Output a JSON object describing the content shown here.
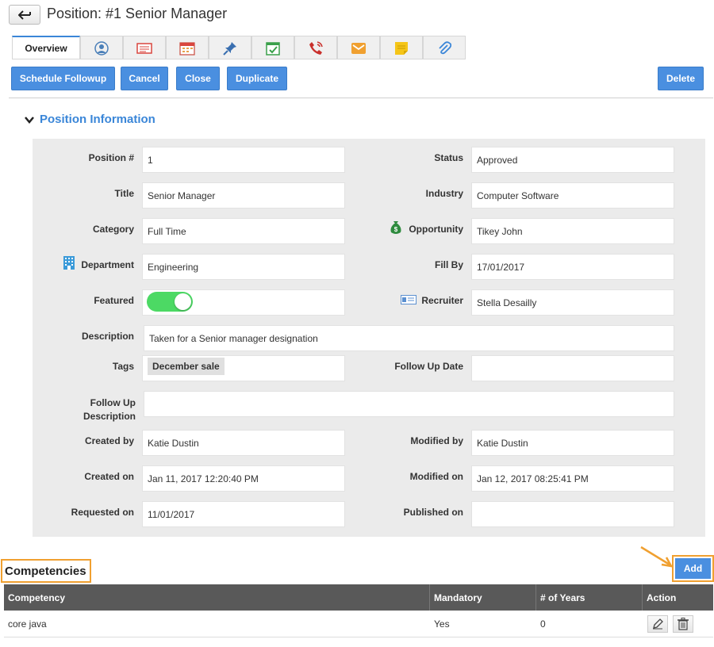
{
  "header": {
    "title": "Position: #1 Senior Manager",
    "back_icon": "back-arrow-icon"
  },
  "tabs": [
    {
      "label": "Overview",
      "icon": "",
      "active": true
    },
    {
      "label": "",
      "icon": "contacts-icon"
    },
    {
      "label": "",
      "icon": "notes-card-icon"
    },
    {
      "label": "",
      "icon": "calendar-icon"
    },
    {
      "label": "",
      "icon": "pin-icon"
    },
    {
      "label": "",
      "icon": "task-calendar-icon"
    },
    {
      "label": "",
      "icon": "phone-call-icon"
    },
    {
      "label": "",
      "icon": "email-icon"
    },
    {
      "label": "",
      "icon": "sticky-note-icon"
    },
    {
      "label": "",
      "icon": "attachment-icon"
    }
  ],
  "toolbar": {
    "schedule_followup": "Schedule Followup",
    "cancel": "Cancel",
    "close": "Close",
    "duplicate": "Duplicate",
    "delete": "Delete"
  },
  "section": {
    "title": "Position Information"
  },
  "fields": {
    "position_no": {
      "label": "Position #",
      "value": "1"
    },
    "status": {
      "label": "Status",
      "value": "Approved"
    },
    "title": {
      "label": "Title",
      "value": "Senior Manager"
    },
    "industry": {
      "label": "Industry",
      "value": "Computer Software"
    },
    "category": {
      "label": "Category",
      "value": "Full Time"
    },
    "opportunity": {
      "label": "Opportunity",
      "value": "Tikey John"
    },
    "department": {
      "label": "Department",
      "value": "Engineering"
    },
    "fill_by": {
      "label": "Fill By",
      "value": "17/01/2017"
    },
    "featured": {
      "label": "Featured",
      "value": true
    },
    "recruiter": {
      "label": "Recruiter",
      "value": "Stella Desailly"
    },
    "description": {
      "label": "Description",
      "value": "Taken for a Senior manager designation"
    },
    "tags": {
      "label": "Tags",
      "value": "December sale"
    },
    "follow_up_date": {
      "label": "Follow Up Date",
      "value": ""
    },
    "follow_up_description": {
      "label_line1": "Follow Up",
      "label_line2": "Description",
      "value": ""
    },
    "created_by": {
      "label": "Created by",
      "value": "Katie Dustin"
    },
    "modified_by": {
      "label": "Modified by",
      "value": "Katie Dustin"
    },
    "created_on": {
      "label": "Created on",
      "value": "Jan 11, 2017 12:20:40 PM"
    },
    "modified_on": {
      "label": "Modified on",
      "value": "Jan 12, 2017 08:25:41 PM"
    },
    "requested_on": {
      "label": "Requested on",
      "value": "11/01/2017"
    },
    "published_on": {
      "label": "Published on",
      "value": ""
    }
  },
  "competencies": {
    "title": "Competencies",
    "add_label": "Add",
    "columns": [
      "Competency",
      "Mandatory",
      "# of Years",
      "Action"
    ],
    "rows": [
      {
        "competency": "core java",
        "mandatory": "Yes",
        "years": "0"
      }
    ]
  },
  "colors": {
    "accent": "#4a8fe0",
    "highlight": "#f0a030",
    "toggle_on": "#4cd964",
    "table_header": "#595959"
  }
}
